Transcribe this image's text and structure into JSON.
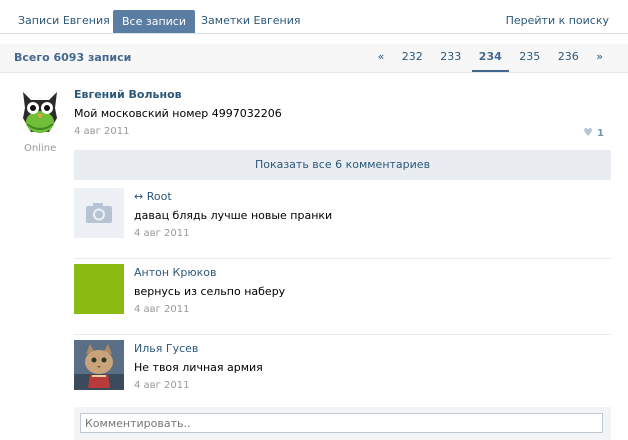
{
  "tabs": [
    {
      "label": "Записи Евгения"
    },
    {
      "label": "Все записи"
    },
    {
      "label": "Заметки Евгения"
    }
  ],
  "search_link": "Перейти к поиску",
  "count_title": "Всего 6093 записи",
  "pager": {
    "prev": "«",
    "pages": [
      "232",
      "233",
      "234",
      "235",
      "236"
    ],
    "current": "234",
    "next": "»"
  },
  "post": {
    "author": "Евгений Вольнов",
    "text": "Мой московский номер 4997032206",
    "date": "4 авг 2011",
    "status": "Online",
    "likes": "1",
    "show_comments": "Показать все 6 комментариев"
  },
  "comments": [
    {
      "name": "↔ Root",
      "text": "давац блядь лучше новые пранки",
      "date": "4 авг 2011",
      "avatar": "camera-placeholder"
    },
    {
      "name": "Антон Крюков",
      "text": "вернусь из сельпо наберу",
      "date": "4 авг 2011",
      "avatar": "green-square"
    },
    {
      "name": "Илья Гусев",
      "text": "Не твоя личная армия",
      "date": "4 авг 2011",
      "avatar": "cat-photo"
    }
  ],
  "comment_placeholder": "Комментировать..",
  "colors": {
    "link": "#2b587a",
    "tab_active": "#597da3",
    "green_avatar": "#8bbb11"
  }
}
